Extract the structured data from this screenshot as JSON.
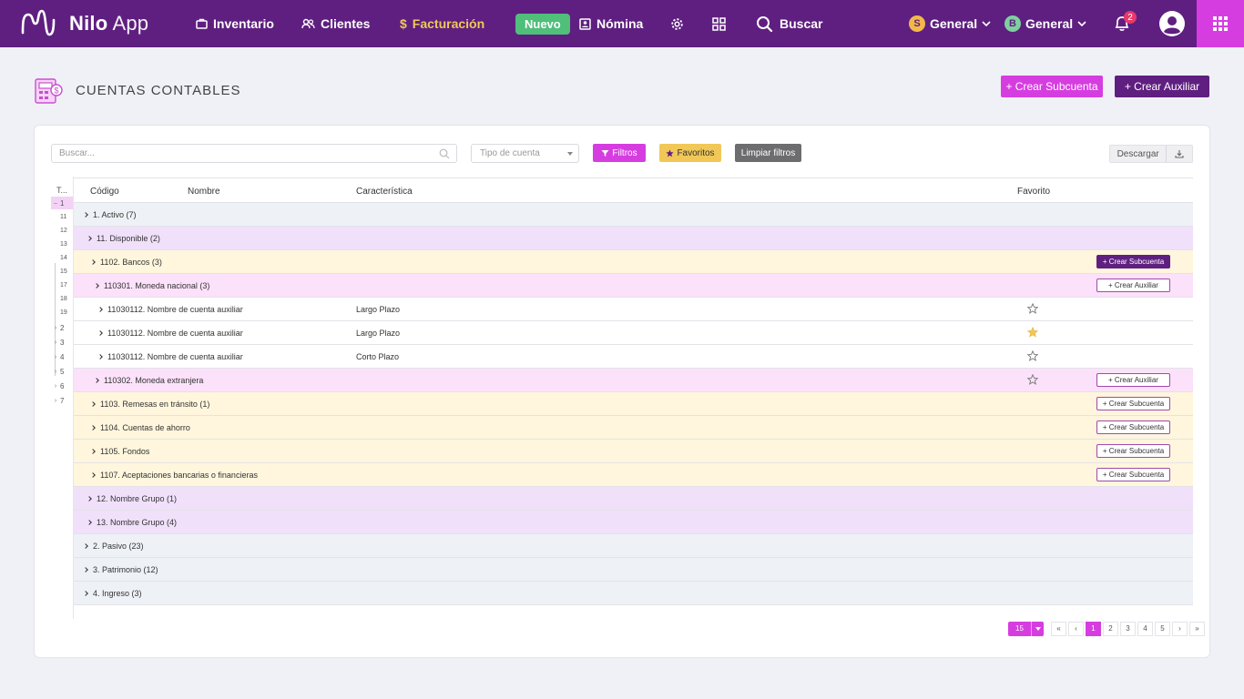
{
  "colors": {
    "nav_bg": "#5f1f80",
    "accent_pink": "#d63de0",
    "accent_purple": "#5f1f80",
    "favorites_yellow": "#f1c857",
    "level1_row": "#eef1f6",
    "level2_row": "#f0e0fa",
    "level3_row": "#fff6dd",
    "level4_row": "#fce1fa",
    "new_badge": "#4fbf7a"
  },
  "nav": {
    "brand_bold": "Nilo",
    "brand_light": "App",
    "items": [
      {
        "label": "Inventario",
        "icon": "briefcase-icon"
      },
      {
        "label": "Clientes",
        "icon": "users-icon"
      },
      {
        "label": "Facturación",
        "icon": "dollar-icon",
        "active": true
      },
      {
        "label": "Nómina",
        "icon": "id-card-icon"
      }
    ],
    "nuevo_badge": "Nuevo",
    "search_label": "Buscar",
    "selector1": {
      "initial": "S",
      "label": "General"
    },
    "selector2": {
      "initial": "B",
      "label": "General"
    },
    "notifications_count": "2"
  },
  "header": {
    "title": "CUENTAS CONTABLES",
    "btn_subcuenta": "+ Crear Subcuenta",
    "btn_auxiliar": "+ Crear Auxiliar"
  },
  "filters": {
    "search_placeholder": "Buscar...",
    "type_placeholder": "Tipo de cuenta",
    "filtros_label": "Filtros",
    "favoritos_label": "Favoritos",
    "limpiar_label": "Limpiar filtros",
    "descargar_label": "Descargar"
  },
  "tree": {
    "header": "T...",
    "items": [
      {
        "label": "1",
        "expanded": true
      },
      {
        "label": "11"
      },
      {
        "label": "12"
      },
      {
        "label": "13"
      },
      {
        "label": "14"
      },
      {
        "label": "15"
      },
      {
        "label": "17"
      },
      {
        "label": "18"
      },
      {
        "label": "19"
      },
      {
        "label": "2"
      },
      {
        "label": "3"
      },
      {
        "label": "4"
      },
      {
        "label": "5"
      },
      {
        "label": "6"
      },
      {
        "label": "7"
      }
    ]
  },
  "table": {
    "columns": {
      "codigo": "Código",
      "nombre": "Nombre",
      "caracteristica": "Característica",
      "favorito": "Favorito"
    },
    "rows": [
      {
        "level": 1,
        "name": "1. Activo (7)",
        "carac": "",
        "fav": "none",
        "button": ""
      },
      {
        "level": 2,
        "name": "11. Disponible (2)",
        "carac": "",
        "fav": "none",
        "button": ""
      },
      {
        "level": 3,
        "name": "1102. Bancos (3)",
        "carac": "",
        "fav": "none",
        "button": "+ Crear Subcuenta",
        "button_style": "solid"
      },
      {
        "level": 4,
        "name": "110301. Moneda nacional (3)",
        "carac": "",
        "fav": "none",
        "button": "+ Crear Auxiliar",
        "button_style": "outline"
      },
      {
        "level": 5,
        "name": "11030112. Nombre de cuenta auxiliar",
        "carac": "Largo Plazo",
        "fav": "empty",
        "button": ""
      },
      {
        "level": 5,
        "name": "11030112. Nombre de cuenta auxiliar",
        "carac": "Largo Plazo",
        "fav": "filled",
        "button": ""
      },
      {
        "level": 5,
        "name": "11030112. Nombre de cuenta auxiliar",
        "carac": "Corto Plazo",
        "fav": "empty",
        "button": ""
      },
      {
        "level": 4,
        "name": "110302. Moneda extranjera",
        "carac": "",
        "fav": "empty",
        "button": "+ Crear Auxiliar",
        "button_style": "outline"
      },
      {
        "level": 3,
        "name": "1103. Remesas en tránsito (1)",
        "carac": "",
        "fav": "none",
        "button": "+ Crear Subcuenta",
        "button_style": "outline"
      },
      {
        "level": 3,
        "name": "1104. Cuentas de ahorro",
        "carac": "",
        "fav": "none",
        "button": "+ Crear Subcuenta",
        "button_style": "outline"
      },
      {
        "level": 3,
        "name": "1105. Fondos",
        "carac": "",
        "fav": "none",
        "button": "+ Crear Subcuenta",
        "button_style": "outline"
      },
      {
        "level": 3,
        "name": "1107. Aceptaciones bancarias o financieras",
        "carac": "",
        "fav": "none",
        "button": "+ Crear Subcuenta",
        "button_style": "outline"
      },
      {
        "level": 2,
        "name": "12. Nombre Grupo (1)",
        "carac": "",
        "fav": "none",
        "button": ""
      },
      {
        "level": 2,
        "name": "13. Nombre Grupo (4)",
        "carac": "",
        "fav": "none",
        "button": ""
      },
      {
        "level": 1,
        "name": "2. Pasivo (23)",
        "carac": "",
        "fav": "none",
        "button": ""
      },
      {
        "level": 1,
        "name": "3. Patrimonio (12)",
        "carac": "",
        "fav": "none",
        "button": ""
      },
      {
        "level": 1,
        "name": "4. Ingreso (3)",
        "carac": "",
        "fav": "none",
        "button": ""
      }
    ]
  },
  "pagination": {
    "page_size": "15",
    "first": "«",
    "prev": "‹",
    "pages": [
      "1",
      "2",
      "3",
      "4",
      "5"
    ],
    "active_page": "1",
    "next": "›",
    "last": "»"
  }
}
